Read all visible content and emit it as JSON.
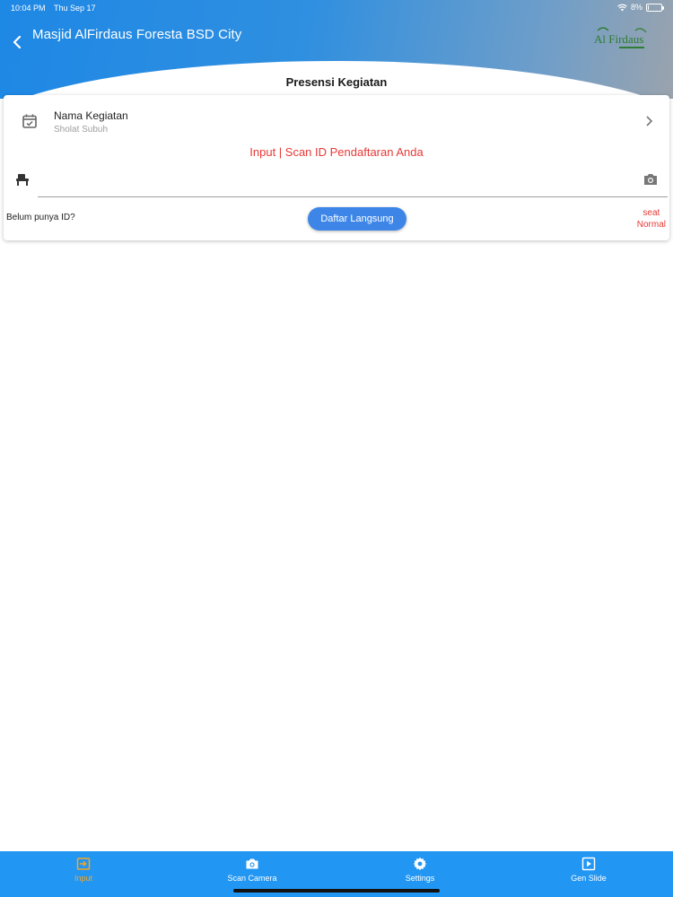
{
  "status_bar": {
    "time": "10:04 PM",
    "date": "Thu Sep 17",
    "battery": "8%",
    "battery_level": 0.08
  },
  "header": {
    "back_label": "‹",
    "title": "Masjid AlFirdaus Foresta BSD City",
    "logo_icon": "alfirdaus-logo"
  },
  "section": {
    "title": "Presensi Kegiatan"
  },
  "activity": {
    "label": "Nama Kegiatan",
    "value": "Sholat Subuh"
  },
  "scan": {
    "hint": "Input | Scan ID Pendaftaran Anda",
    "input_value": "",
    "input_placeholder": ""
  },
  "register": {
    "prompt": "Belum punya ID?",
    "button_label": "Daftar Langsung",
    "seat_label": "seat",
    "seat_mode": "Normal"
  },
  "bottom_nav": {
    "items": [
      {
        "label": "Input",
        "icon": "input-icon",
        "active": true
      },
      {
        "label": "Scan Camera",
        "icon": "camera-icon",
        "active": false
      },
      {
        "label": "Settings",
        "icon": "gear-icon",
        "active": false
      },
      {
        "label": "Gen Slide",
        "icon": "play-slide-icon",
        "active": false
      }
    ]
  },
  "colors": {
    "primary": "#2196f3",
    "accent_red": "#e53935",
    "active_nav": "#f5a623",
    "button": "#3d86e8"
  }
}
